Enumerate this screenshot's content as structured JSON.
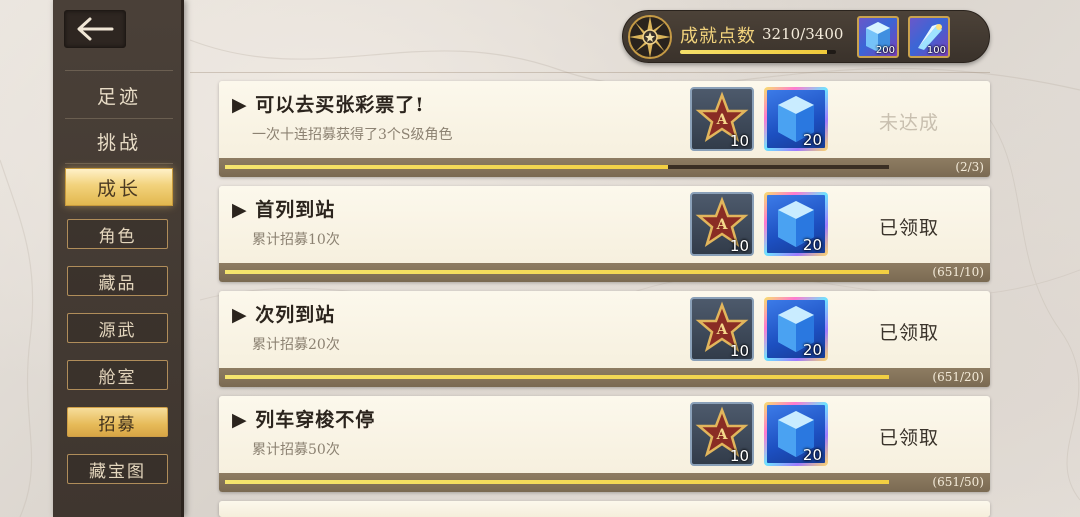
{
  "sidebar": {
    "back_icon": "arrow-left-icon",
    "main_items": [
      {
        "label": "足迹",
        "active": false
      },
      {
        "label": "挑战",
        "active": false
      },
      {
        "label": "成长",
        "active": true
      }
    ],
    "sub_items": [
      {
        "label": "角色",
        "active": false
      },
      {
        "label": "藏品",
        "active": false
      },
      {
        "label": "源武",
        "active": false
      },
      {
        "label": "舱室",
        "active": false
      },
      {
        "label": "招募",
        "active": true
      },
      {
        "label": "藏宝图",
        "active": false
      }
    ]
  },
  "header": {
    "points_label": "成就点数",
    "points_value": "3210/3400",
    "points_progress": 0.944,
    "rewards": [
      {
        "icon": "crystal-icon",
        "count": "200"
      },
      {
        "icon": "crystal-shard-icon",
        "count": "100"
      }
    ]
  },
  "achievements": [
    {
      "title": "▶ 可以去买张彩票了!",
      "desc": "一次十连招募获得了3个S级角色",
      "reward_star_count": "10",
      "reward_cube_count": "20",
      "status": "未达成",
      "progress_text": "(2/3)",
      "progress": 0.667
    },
    {
      "title": "▶ 首列到站",
      "desc": "累计招募10次",
      "reward_star_count": "10",
      "reward_cube_count": "20",
      "status": "已领取",
      "progress_text": "(651/10)",
      "progress": 1.0
    },
    {
      "title": "▶ 次列到站",
      "desc": "累计招募20次",
      "reward_star_count": "10",
      "reward_cube_count": "20",
      "status": "已领取",
      "progress_text": "(651/20)",
      "progress": 1.0
    },
    {
      "title": "▶ 列车穿梭不停",
      "desc": "累计招募50次",
      "reward_star_count": "10",
      "reward_cube_count": "20",
      "status": "已领取",
      "progress_text": "(651/50)",
      "progress": 1.0
    }
  ],
  "colors": {
    "accent_gold": "#f2cf42",
    "sidebar_bg": "#4a4038",
    "card_bg": "#fcf8ec",
    "status_pending": "#c8bfaf"
  }
}
